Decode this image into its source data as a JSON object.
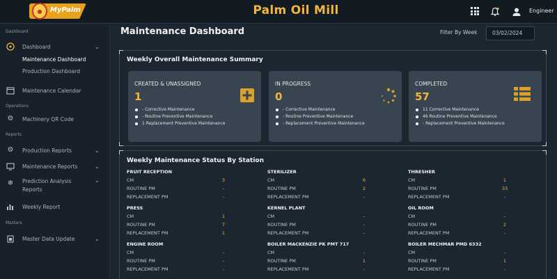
{
  "header": {
    "logo_text": "MyPalm",
    "app_title": "Palm Oil Mill",
    "user_label": "Engineer",
    "icons": [
      "grid-icon",
      "bell-icon",
      "user-icon"
    ]
  },
  "sidebar": {
    "sections": {
      "dashboard": "Dashboard",
      "operations": "Operations",
      "reports": "Reports",
      "masters": "Masters"
    },
    "items": {
      "dashboard": "Dashboard",
      "maintenance_dashboard": "Maintenance Dashboard",
      "production_dashboard": "Production Dashboard",
      "maintenance_calendar": "Maintenance Calendar",
      "machinery_qr": "Machinery QR Code",
      "production_reports": "Production Reports",
      "maintenance_reports": "Maintenance Reports",
      "prediction_analysis": "Prediction Analysis",
      "prediction_analysis_2": "Reports",
      "weekly_report": "Weekly Report",
      "master_data_update": "Master Data Update"
    }
  },
  "main": {
    "title": "Maintenance Dashboard",
    "filter_label": "Filter By Week",
    "filter_value": "03/02/2024",
    "summary": {
      "title": "Weekly Overall Maintenance Summary",
      "cards": [
        {
          "title": "CREATED & UNASSIGNED",
          "count": "1",
          "lines": [
            "- Corrective Maintenance",
            "- Routine Preventive Maintenance",
            "1 Replacement Preventive Maintenance"
          ]
        },
        {
          "title": "IN PROGRESS",
          "count": "0",
          "lines": [
            "- Corrective Maintenance",
            "- Routine Preventive Maintenance",
            "- Replacement Preventive Maintenance"
          ]
        },
        {
          "title": "COMPLETED",
          "count": "57",
          "lines": [
            "11 Corrective Maintenance",
            "46 Routine Preventive Maintenance",
            "- Replacement Preventive Maintenance"
          ]
        }
      ]
    },
    "status": {
      "title": "Weekly Maintenance Status By Station",
      "row_labels": [
        "CM",
        "ROUTINE PM",
        "REPLACEMENT PM"
      ],
      "stations": [
        {
          "name": "FRUIT RECEPTION",
          "values": [
            "3",
            "-",
            "-"
          ]
        },
        {
          "name": "STERILIZER",
          "values": [
            "6",
            "2",
            "-"
          ]
        },
        {
          "name": "THRESHER",
          "values": [
            "1",
            "33",
            "-"
          ]
        },
        {
          "name": "PRESS",
          "values": [
            "1",
            "7",
            "1"
          ]
        },
        {
          "name": "KERNEL PLANT",
          "values": [
            "-",
            "-",
            "-"
          ]
        },
        {
          "name": "OIL ROOM",
          "values": [
            "-",
            "2",
            "-"
          ]
        },
        {
          "name": "ENGINE ROOM",
          "values": [
            "-",
            "-",
            "-"
          ]
        },
        {
          "name": "BOILER MACKENZIE PK PMT 717",
          "values": [
            "-",
            "1",
            "-"
          ]
        },
        {
          "name": "BOILER MECHMAR PMD 6332",
          "values": [
            "-",
            "1",
            "-"
          ]
        }
      ]
    }
  },
  "colors": {
    "accent": "#f2b63c",
    "background": "#1c2630",
    "card": "#38444f"
  }
}
